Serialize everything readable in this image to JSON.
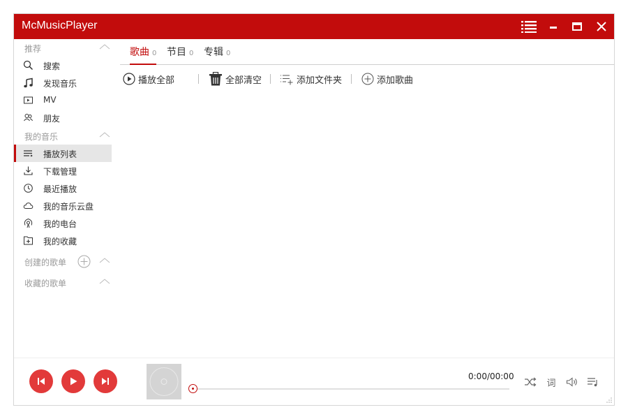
{
  "app": {
    "title": "McMusicPlayer",
    "accent_color": "#c20c0c"
  },
  "titlebar": {
    "buttons": [
      {
        "name": "menu",
        "icon": "list-icon"
      },
      {
        "name": "minimize",
        "icon": "minimize-icon"
      },
      {
        "name": "maximize",
        "icon": "maximize-icon"
      },
      {
        "name": "close",
        "icon": "close-icon"
      }
    ]
  },
  "sidebar": {
    "sections": [
      {
        "title": "推荐",
        "items": [
          {
            "label": "搜索",
            "icon": "search-icon"
          },
          {
            "label": "发现音乐",
            "icon": "music-note-icon"
          },
          {
            "label": "MV",
            "icon": "video-icon"
          },
          {
            "label": "朋友",
            "icon": "friends-icon"
          }
        ]
      },
      {
        "title": "我的音乐",
        "items": [
          {
            "label": "播放列表",
            "icon": "playlist-icon",
            "active": true
          },
          {
            "label": "下载管理",
            "icon": "download-icon"
          },
          {
            "label": "最近播放",
            "icon": "clock-icon"
          },
          {
            "label": "我的音乐云盘",
            "icon": "cloud-icon"
          },
          {
            "label": "我的电台",
            "icon": "radio-icon"
          },
          {
            "label": "我的收藏",
            "icon": "collection-icon"
          }
        ]
      },
      {
        "title": "创建的歌单"
      },
      {
        "title": "收藏的歌单"
      }
    ]
  },
  "tabs": [
    {
      "label": "歌曲",
      "count": "0",
      "active": true
    },
    {
      "label": "节目",
      "count": "0"
    },
    {
      "label": "专辑",
      "count": "0"
    }
  ],
  "toolbar": {
    "play_all": "播放全部",
    "clear_all": "全部清空",
    "add_folder": "添加文件夹",
    "add_song": "添加歌曲"
  },
  "player": {
    "time": "0:00/00:00",
    "progress": 0,
    "lyrics_label": "词",
    "controls": [
      "previous-icon",
      "play-icon",
      "next-icon",
      "shuffle-icon",
      "lyrics-icon",
      "volume-icon",
      "playlist-icon"
    ]
  }
}
